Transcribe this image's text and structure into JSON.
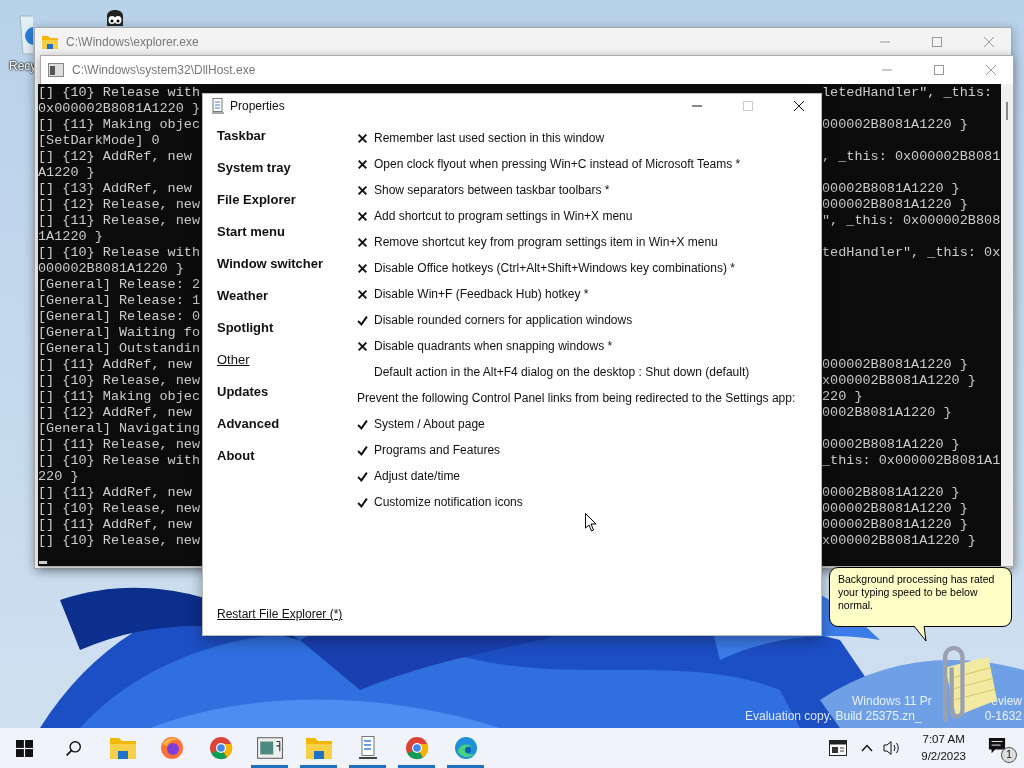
{
  "desktop": {
    "icons": [
      {
        "kind": "recycle-bin",
        "label": "Recy"
      },
      {
        "kind": "eyes"
      }
    ],
    "watermark": {
      "line_1": [
        "Windows 11 Pr",
        "eview"
      ],
      "line_2": [
        "Evaluation copy. Build 25375.zn_",
        "0-1632"
      ]
    }
  },
  "explorer_window": {
    "title": "C:\\Windows\\explorer.exe"
  },
  "console_window": {
    "title": "C:\\Windows\\system32\\DllHost.exe",
    "lines": [
      {
        "left": "[] {10} Release with",
        "right": "letedHandler\", _this:"
      },
      {
        "left": "0x000002B8081A1220 }"
      },
      {
        "left": "[] {11} Making objec",
        "right": "000002B8081A1220 }"
      },
      {
        "left": "[SetDarkMode] 0"
      },
      {
        "left": "[] {12} AddRef, new",
        "right": ", _this: 0x000002B8081"
      },
      {
        "left": "A1220 }"
      },
      {
        "left": "[] {13} AddRef, new",
        "right": "00002B8081A1220 }"
      },
      {
        "left": "[] {12} Release, new",
        "right": "000002B8081A1220 }"
      },
      {
        "left": "[] {11} Release, new",
        "right": "\", _this: 0x000002B808"
      },
      {
        "left": "1A1220 }"
      },
      {
        "left": "[] {10} Release with",
        "right": "tedHandler\", _this: 0x"
      },
      {
        "left": "000002B8081A1220 }"
      },
      {
        "left": "[General] Release: 2"
      },
      {
        "left": "[General] Release: 1"
      },
      {
        "left": "[General] Release: 0"
      },
      {
        "left": "[General] Waiting fo"
      },
      {
        "left": "[General] Outstandin"
      },
      {
        "left": "[] {11} AddRef, new",
        "right": "000002B8081A1220 }"
      },
      {
        "left": "[] {10} Release, new",
        "right": "x000002B8081A1220 }"
      },
      {
        "left": "[] {11} Making objec",
        "right": "220 }"
      },
      {
        "left": "[] {12} AddRef, new",
        "right": "0002B8081A1220 }"
      },
      {
        "left": "[General] Navigating"
      },
      {
        "left": "[] {11} Release, new",
        "right": "00002B8081A1220 }"
      },
      {
        "left": "[] {10} Release with",
        "right": "_this: 0x000002B8081A1"
      },
      {
        "left": "220 }"
      },
      {
        "left": "[] {11} AddRef, new",
        "right": "00002B8081A1220 }"
      },
      {
        "left": "[] {10} Release, new",
        "right": "000002B8081A1220 }"
      },
      {
        "left": "[] {11} AddRef, new",
        "right": "000002B8081A1220 }"
      },
      {
        "left": "[] {10} Release, new",
        "right": "x000002B8081A1220 }"
      }
    ]
  },
  "properties": {
    "title": "Properties",
    "can_maximize": false,
    "sidebar": [
      {
        "label": "Taskbar",
        "selected": false
      },
      {
        "label": "System tray",
        "selected": false
      },
      {
        "label": "File Explorer",
        "selected": false
      },
      {
        "label": "Start menu",
        "selected": false
      },
      {
        "label": "Window switcher",
        "selected": false
      },
      {
        "label": "Weather",
        "selected": false
      },
      {
        "label": "Spotlight",
        "selected": false
      },
      {
        "label": "Other",
        "selected": true
      },
      {
        "label": "Updates",
        "selected": false
      },
      {
        "label": "Advanced",
        "selected": false
      },
      {
        "label": "About",
        "selected": false
      }
    ],
    "options": [
      {
        "kind": "toggle",
        "label": "Remember last used section in this window",
        "checked": false
      },
      {
        "kind": "toggle",
        "label": "Open clock flyout when pressing Win+C instead of Microsoft Teams *",
        "checked": false
      },
      {
        "kind": "toggle",
        "label": "Show separators between taskbar toolbars *",
        "checked": false
      },
      {
        "kind": "toggle",
        "label": "Add shortcut to program settings in Win+X menu",
        "checked": false
      },
      {
        "kind": "toggle",
        "label": "Remove shortcut key from program settings item in Win+X menu",
        "checked": false
      },
      {
        "kind": "toggle",
        "label": "Disable Office hotkeys (Ctrl+Alt+Shift+Windows key combinations) *",
        "checked": false
      },
      {
        "kind": "toggle",
        "label": "Disable Win+F (Feedback Hub) hotkey *",
        "checked": false
      },
      {
        "kind": "toggle",
        "label": "Disable rounded corners for application windows",
        "checked": true
      },
      {
        "kind": "toggle",
        "label": "Disable quadrants when snapping windows *",
        "checked": false
      },
      {
        "kind": "choice",
        "label": "Default action in the Alt+F4 dialog on the desktop : Shut down (default)"
      },
      {
        "kind": "heading",
        "label": "Prevent the following Control Panel links from being redirected to the Settings app:"
      },
      {
        "kind": "toggle",
        "label": "System / About page",
        "checked": true
      },
      {
        "kind": "toggle",
        "label": "Programs and Features",
        "checked": true
      },
      {
        "kind": "toggle",
        "label": "Adjust date/time",
        "checked": true
      },
      {
        "kind": "toggle",
        "label": "Customize notification icons",
        "checked": true
      }
    ],
    "restart_link": "Restart File Explorer (*)"
  },
  "balloon": {
    "text": "Background processing has rated your typing speed to be below normal."
  },
  "taskbar": {
    "apps": [
      {
        "kind": "start",
        "running": false
      },
      {
        "kind": "search",
        "running": false
      },
      {
        "kind": "folder",
        "running": false
      },
      {
        "kind": "firefox",
        "running": false
      },
      {
        "kind": "chrome",
        "running": false
      },
      {
        "kind": "window",
        "running": true
      },
      {
        "kind": "folder",
        "running": true
      },
      {
        "kind": "notepad",
        "running": true
      },
      {
        "kind": "chrome",
        "running": true
      },
      {
        "kind": "edge",
        "running": true
      }
    ],
    "time": "7:07 AM",
    "date": "9/2/2023",
    "notification_count": "1"
  }
}
